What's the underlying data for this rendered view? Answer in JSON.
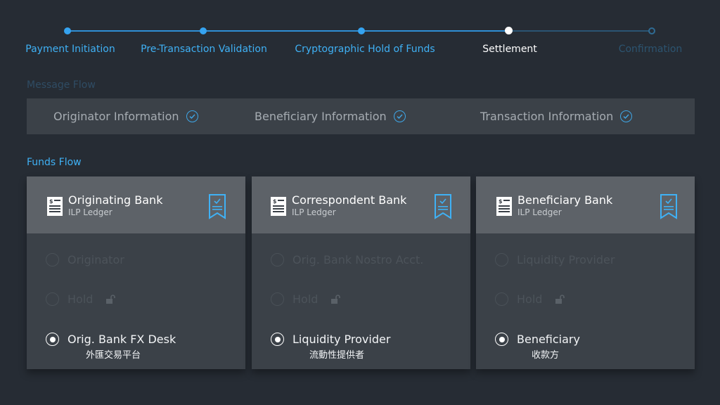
{
  "stepper": {
    "steps": [
      {
        "label": "Payment Initiation",
        "state": "done"
      },
      {
        "label": "Pre-Transaction Validation",
        "state": "done"
      },
      {
        "label": "Cryptographic Hold of Funds",
        "state": "done"
      },
      {
        "label": "Settlement",
        "state": "current"
      },
      {
        "label": "Confirmation",
        "state": "todo"
      }
    ]
  },
  "message_flow": {
    "title": "Message Flow",
    "items": [
      {
        "label": "Originator Information"
      },
      {
        "label": "Beneficiary Information"
      },
      {
        "label": "Transaction Information"
      }
    ]
  },
  "funds_flow": {
    "title": "Funds Flow",
    "cards": [
      {
        "name": "Originating Bank",
        "ledger": "ILP Ledger",
        "parties": [
          {
            "label": "Originator",
            "state": "dim"
          },
          {
            "label": "Hold",
            "state": "dim",
            "icon": "unlock-icon"
          },
          {
            "label": "Orig. Bank FX Desk",
            "sublabel": "外匯交易平台",
            "state": "active"
          }
        ]
      },
      {
        "name": "Correspondent Bank",
        "ledger": "ILP Ledger",
        "parties": [
          {
            "label": "Orig. Bank Nostro Acct.",
            "state": "dim"
          },
          {
            "label": "Hold",
            "state": "dim",
            "icon": "unlock-icon"
          },
          {
            "label": "Liquidity Provider",
            "sublabel": "流動性提供者",
            "state": "active"
          }
        ]
      },
      {
        "name": "Beneficiary Bank",
        "ledger": "ILP Ledger",
        "parties": [
          {
            "label": "Liquidity Provider",
            "state": "dim"
          },
          {
            "label": "Hold",
            "state": "dim",
            "icon": "unlock-icon"
          },
          {
            "label": "Beneficiary",
            "sublabel": "收款方",
            "state": "active"
          }
        ]
      }
    ]
  },
  "colors": {
    "background": "#262c34",
    "accent": "#3fb1f5",
    "panel": "#3b4148",
    "card_header": "#5d6268"
  }
}
